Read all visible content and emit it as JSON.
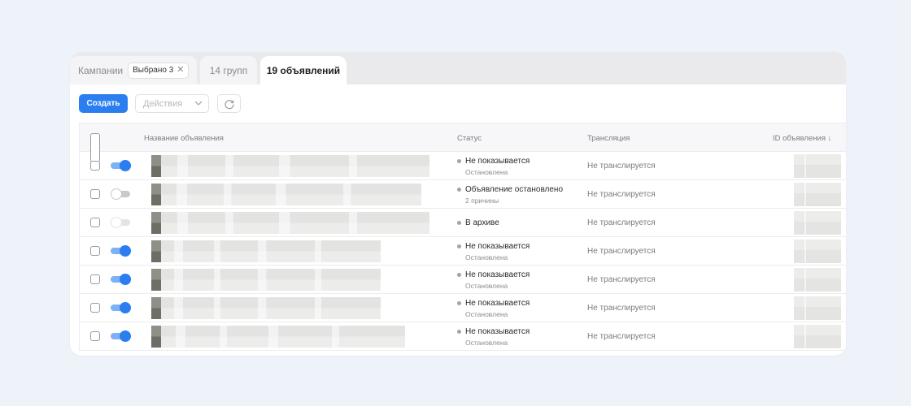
{
  "tabs": {
    "campaigns_label": "Кампании",
    "selected_chip": "Выбрано 3",
    "chip_close_icon": "close-icon",
    "groups_label": "14 групп",
    "ads_label": "19 объявлений"
  },
  "toolbar": {
    "create_label": "Создать",
    "actions_placeholder": "Действия",
    "actions_icon": "chevron-down-icon",
    "refresh_icon": "refresh-icon"
  },
  "table": {
    "columns": {
      "name": "Название объявления",
      "status": "Статус",
      "broadcast": "Трансляция",
      "id": "ID объявления ↓"
    },
    "rows": [
      {
        "toggle": "on",
        "status": "Не показывается",
        "substatus": "Остановлена",
        "broadcast": "Не транслируется"
      },
      {
        "toggle": "off",
        "status": "Объявление остановлено",
        "substatus": "2 причины",
        "broadcast": "Не транслируется"
      },
      {
        "toggle": "disabled",
        "status": "В архиве",
        "substatus": "",
        "broadcast": "Не транслируется"
      },
      {
        "toggle": "on",
        "status": "Не показывается",
        "substatus": "Остановлена",
        "broadcast": "Не транслируется"
      },
      {
        "toggle": "on",
        "status": "Не показывается",
        "substatus": "Остановлена",
        "broadcast": "Не транслируется"
      },
      {
        "toggle": "on",
        "status": "Не показывается",
        "substatus": "Остановлена",
        "broadcast": "Не транслируется"
      },
      {
        "toggle": "on",
        "status": "Не показывается",
        "substatus": "Остановлена",
        "broadcast": "Не транслируется"
      }
    ]
  },
  "colors": {
    "accent": "#2a7ef0",
    "page_background": "#edf3f9"
  }
}
